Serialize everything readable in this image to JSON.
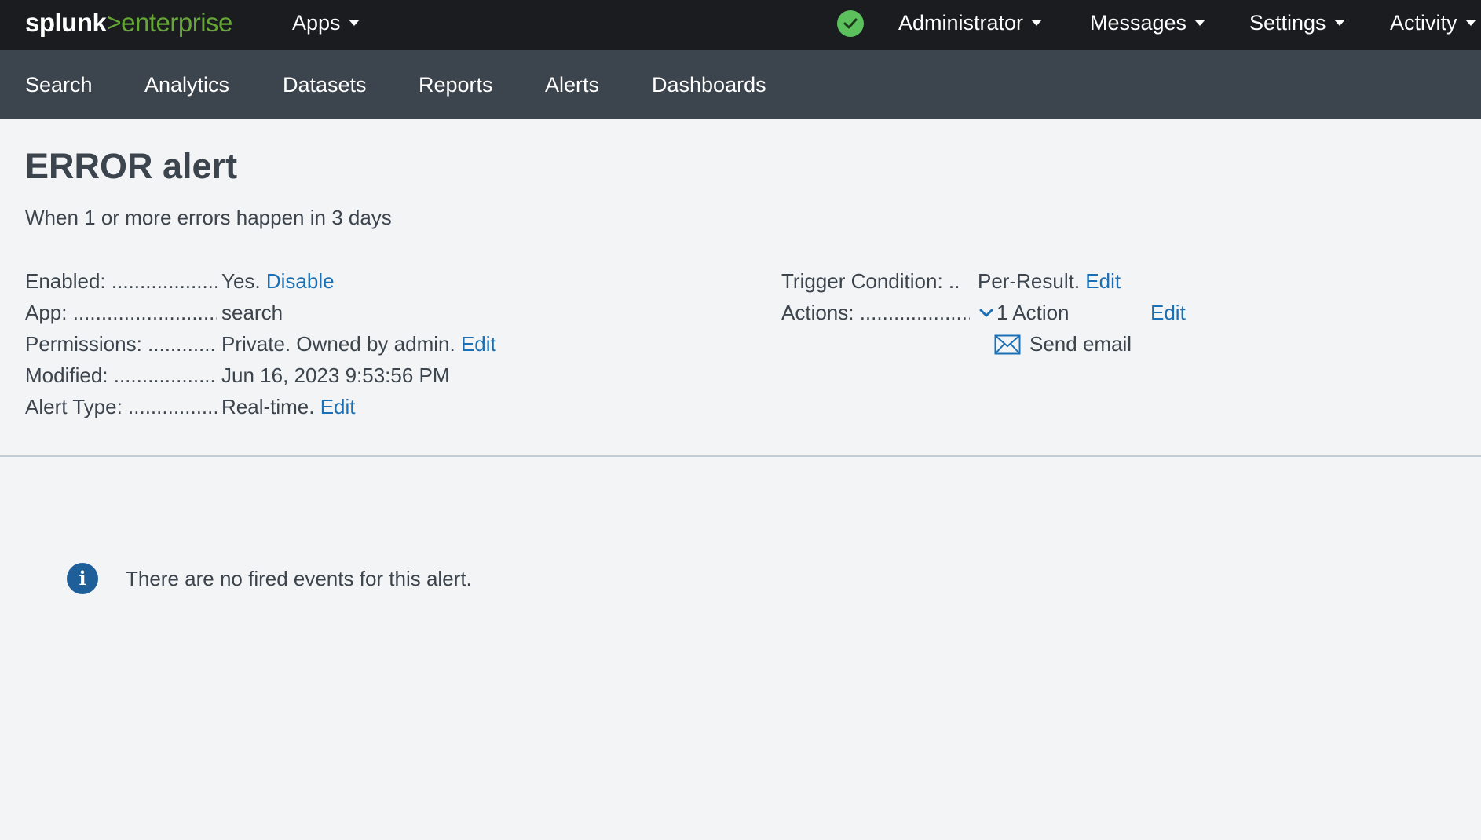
{
  "topbar": {
    "logo": {
      "splunk": "splunk",
      "gt": ">",
      "enterprise": "enterprise"
    },
    "apps_label": "Apps",
    "health_icon": "check-circle-icon",
    "administrator_label": "Administrator",
    "messages_label": "Messages",
    "settings_label": "Settings",
    "activity_label": "Activity"
  },
  "appbar": {
    "items": [
      "Search",
      "Analytics",
      "Datasets",
      "Reports",
      "Alerts",
      "Dashboards"
    ]
  },
  "alert": {
    "title": "ERROR alert",
    "description": "When 1 or more errors happen in 3 days",
    "left": [
      {
        "label": "Enabled: ....................",
        "value": "Yes.",
        "link": "Disable"
      },
      {
        "label": "App: ..........................",
        "value": "search",
        "link": ""
      },
      {
        "label": "Permissions: ............",
        "value": "Private. Owned by admin.",
        "link": "Edit"
      },
      {
        "label": "Modified: ..................",
        "value": "Jun 16, 2023 9:53:56 PM",
        "link": ""
      },
      {
        "label": "Alert Type: ................",
        "value": "Real-time.",
        "link": "Edit"
      }
    ],
    "trigger": {
      "label": "Trigger Condition: ..",
      "value": "Per-Result.",
      "link": "Edit"
    },
    "actions": {
      "label": "Actions: ....................",
      "count": "1 Action",
      "link": "Edit",
      "item": "Send email",
      "item_icon": "envelope-icon",
      "toggle_icon": "chevron-down-icon"
    }
  },
  "empty_state": {
    "icon": "info-icon",
    "icon_glyph": "i",
    "message": "There are no fired events for this alert."
  },
  "colors": {
    "topbar_bg": "#1a1c20",
    "appbar_bg": "#3c444d",
    "page_bg": "#f3f4f5",
    "brand_green": "#65a637",
    "link_blue": "#1a6fb5",
    "health_green": "#5cc05c",
    "info_blue": "#1e5f99"
  }
}
